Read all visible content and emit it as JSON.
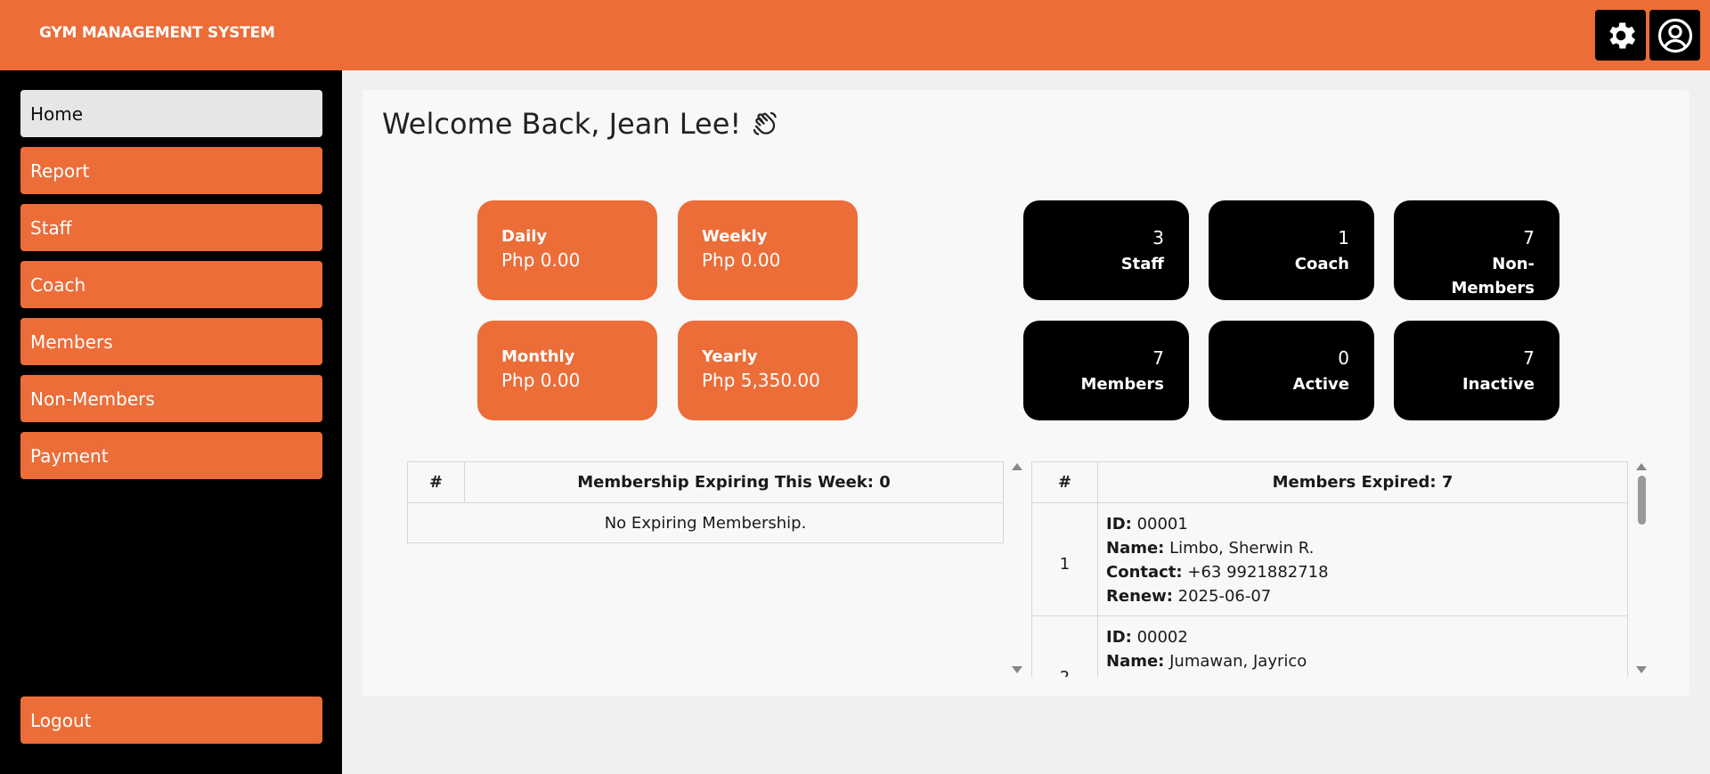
{
  "header": {
    "title": "GYM MANAGEMENT SYSTEM"
  },
  "sidebar": {
    "items": [
      {
        "label": "Home"
      },
      {
        "label": "Report"
      },
      {
        "label": "Staff"
      },
      {
        "label": "Coach"
      },
      {
        "label": "Members"
      },
      {
        "label": "Non-Members"
      },
      {
        "label": "Payment"
      }
    ],
    "logout": "Logout"
  },
  "welcome": {
    "text": "Welcome Back, Jean Lee!"
  },
  "income": {
    "daily": {
      "label": "Daily",
      "value": "Php 0.00"
    },
    "weekly": {
      "label": "Weekly",
      "value": "Php 0.00"
    },
    "monthly": {
      "label": "Monthly",
      "value": "Php 0.00"
    },
    "yearly": {
      "label": "Yearly",
      "value": "Php 5,350.00"
    }
  },
  "counts": {
    "staff": {
      "num": "3",
      "label": "Staff"
    },
    "coach": {
      "num": "1",
      "label": "Coach"
    },
    "nonmembers": {
      "num": "7",
      "label": "Non-Members"
    },
    "members": {
      "num": "7",
      "label": "Members"
    },
    "active": {
      "num": "0",
      "label": "Active"
    },
    "inactive": {
      "num": "7",
      "label": "Inactive"
    }
  },
  "expiring": {
    "col_num": "#",
    "col_title": "Membership Expiring This Week: 0",
    "empty": "No Expiring Membership."
  },
  "expired": {
    "col_num": "#",
    "col_title": "Members Expired: 7",
    "labels": {
      "id": "ID:",
      "name": "Name:",
      "contact": "Contact:",
      "renew": "Renew:"
    },
    "rows": [
      {
        "num": "1",
        "id": "00001",
        "name": "Limbo, Sherwin R.",
        "contact": "+63 9921882718",
        "renew": "2025-06-07"
      },
      {
        "num": "2",
        "id": "00002",
        "name": "Jumawan, Jayrico",
        "contact": "",
        "renew": ""
      }
    ]
  },
  "colors": {
    "accent": "#ec6d38",
    "dark": "#000000"
  },
  "icons": {
    "settings": "gear-icon",
    "profile": "user-circle-icon",
    "welcome": "waving-hand-icon"
  }
}
